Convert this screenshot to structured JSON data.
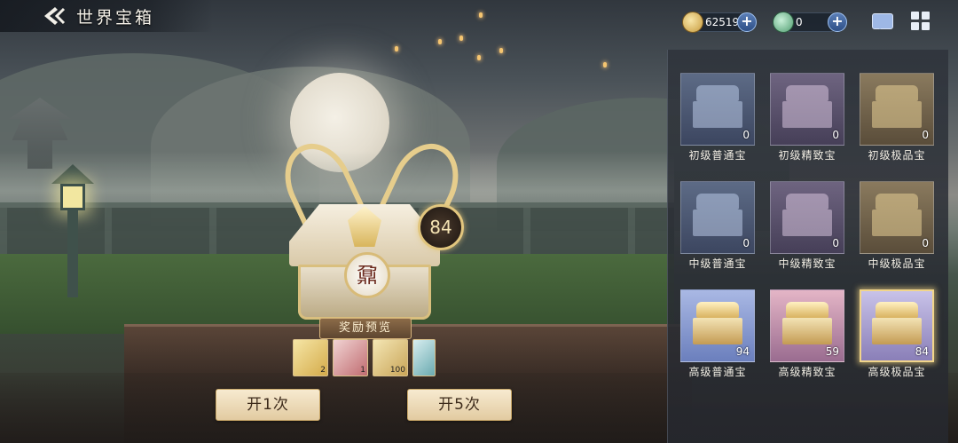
{
  "header": {
    "title": "世界宝箱"
  },
  "currency": [
    {
      "icon": "gold-dragon-coin-icon",
      "value": "62519"
    },
    {
      "icon": "jade-dragon-coin-icon",
      "value": "0"
    }
  ],
  "current_chest": {
    "count": "84",
    "seal_glyph": "鼐"
  },
  "reward_preview": {
    "title": "奖励预览",
    "items": [
      {
        "icon": "gold-token-icon",
        "qty": "2"
      },
      {
        "icon": "scroll-icon",
        "qty": "1"
      },
      {
        "icon": "gold-dragon-icon",
        "qty": "100"
      },
      {
        "icon": "jade-ticket-icon",
        "qty": ""
      }
    ]
  },
  "buttons": {
    "open_once": "开1次",
    "open_five": "开5次"
  },
  "chests": [
    {
      "label": "初级普通宝",
      "count": "0",
      "tier": "blue",
      "owned": false
    },
    {
      "label": "初级精致宝",
      "count": "0",
      "tier": "purple",
      "owned": false
    },
    {
      "label": "初级极品宝",
      "count": "0",
      "tier": "gold",
      "owned": false
    },
    {
      "label": "中级普通宝",
      "count": "0",
      "tier": "blue",
      "owned": false
    },
    {
      "label": "中级精致宝",
      "count": "0",
      "tier": "purple",
      "owned": false
    },
    {
      "label": "中级极品宝",
      "count": "0",
      "tier": "gold",
      "owned": false
    },
    {
      "label": "高级普通宝",
      "count": "94",
      "tier": "blue",
      "owned": true
    },
    {
      "label": "高级精致宝",
      "count": "59",
      "tier": "purple",
      "owned": true
    },
    {
      "label": "高级极品宝",
      "count": "84",
      "tier": "gold",
      "owned": true,
      "selected": true
    }
  ]
}
